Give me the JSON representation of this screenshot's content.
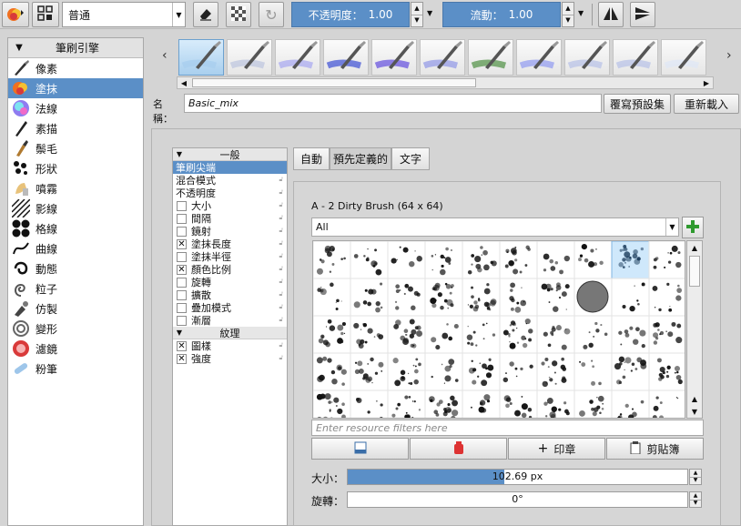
{
  "toolbar": {
    "blend_mode": "普通",
    "opacity_label": "不透明度：",
    "opacity_value": "1.00",
    "flow_label": "流動：",
    "flow_value": "1.00"
  },
  "engines": {
    "header": "筆刷引擎",
    "items": [
      {
        "label": "像素",
        "icon": "pixel-brush-icon"
      },
      {
        "label": "塗抹",
        "icon": "smudge-icon"
      },
      {
        "label": "法線",
        "icon": "tangent-normal-icon"
      },
      {
        "label": "素描",
        "icon": "sketch-icon"
      },
      {
        "label": "鬃毛",
        "icon": "bristle-icon"
      },
      {
        "label": "形狀",
        "icon": "shape-icon"
      },
      {
        "label": "噴霧",
        "icon": "spray-icon"
      },
      {
        "label": "影線",
        "icon": "hatching-icon"
      },
      {
        "label": "格線",
        "icon": "grid-icon"
      },
      {
        "label": "曲線",
        "icon": "curve-icon"
      },
      {
        "label": "動態",
        "icon": "dyna-icon"
      },
      {
        "label": "粒子",
        "icon": "particle-icon"
      },
      {
        "label": "仿製",
        "icon": "clone-icon"
      },
      {
        "label": "變形",
        "icon": "deform-icon"
      },
      {
        "label": "濾鏡",
        "icon": "filter-icon"
      },
      {
        "label": "粉筆",
        "icon": "chalk-icon"
      }
    ],
    "selected_index": 1
  },
  "preset": {
    "name_label": "名稱：",
    "name_value": "Basic_mix",
    "overwrite_button": "覆寫預設集",
    "reload_button": "重新載入"
  },
  "options": {
    "general_header": "一般",
    "texture_header": "紋理",
    "items": [
      {
        "label": "筆刷尖端",
        "checkbox": false,
        "checked": false,
        "selected": true
      },
      {
        "label": "混合模式",
        "checkbox": false,
        "checked": false
      },
      {
        "label": "不透明度",
        "checkbox": false,
        "checked": false
      },
      {
        "label": "大小",
        "checkbox": true,
        "checked": false
      },
      {
        "label": "間隔",
        "checkbox": true,
        "checked": false
      },
      {
        "label": "鏡射",
        "checkbox": true,
        "checked": false
      },
      {
        "label": "塗抹長度",
        "checkbox": true,
        "checked": true
      },
      {
        "label": "塗抹半徑",
        "checkbox": true,
        "checked": false
      },
      {
        "label": "顏色比例",
        "checkbox": true,
        "checked": true
      },
      {
        "label": "旋轉",
        "checkbox": true,
        "checked": false
      },
      {
        "label": "擴散",
        "checkbox": true,
        "checked": false
      },
      {
        "label": "疊加模式",
        "checkbox": true,
        "checked": false
      },
      {
        "label": "漸層",
        "checkbox": true,
        "checked": false
      }
    ],
    "texture_items": [
      {
        "label": "圖樣",
        "checked": true
      },
      {
        "label": "強度",
        "checked": true
      }
    ]
  },
  "tip": {
    "tabs": [
      "自動",
      "預先定義的",
      "文字"
    ],
    "selected_tab": 1,
    "brush_name": "A - 2 Dirty Brush (64 x 64)",
    "tag_filter": "All",
    "filter_placeholder": "Enter resource filters here",
    "stamp_button": "印章",
    "clipboard_button": "剪貼簿",
    "size_label": "大小：",
    "size_value": "102.69 px",
    "size_fraction": 0.46,
    "rotation_label": "旋轉：",
    "rotation_value": "0°"
  },
  "colors": {
    "accent": "#5b8fc7",
    "selected_thumb": "#cfe8fb"
  }
}
